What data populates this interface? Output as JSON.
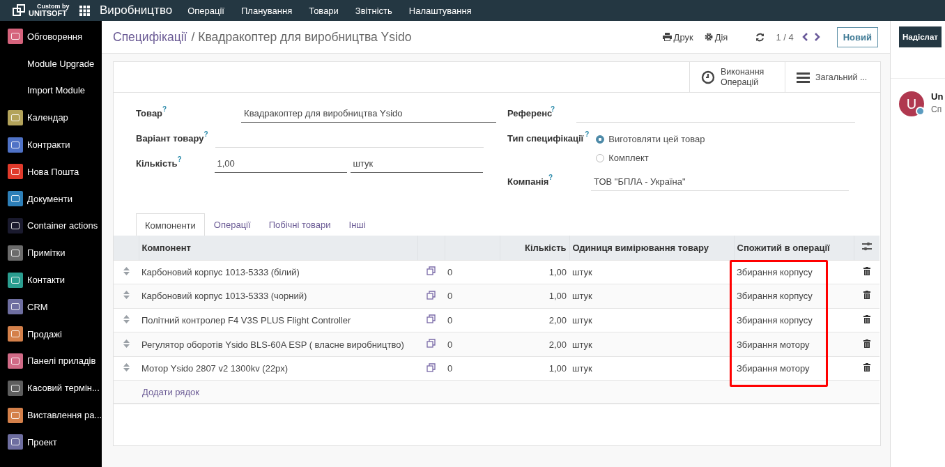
{
  "topbar": {
    "logo_top": "Custom by",
    "logo_bottom": "UNITSOFT",
    "app_name": "Виробництво",
    "menu": [
      "Операції",
      "Планування",
      "Товари",
      "Звітність",
      "Налаштування"
    ]
  },
  "sidebar": {
    "items": [
      {
        "label": "Обговорення"
      },
      {
        "label": "Module Upgrade"
      },
      {
        "label": "Import Module"
      },
      {
        "label": "Календар"
      },
      {
        "label": "Контракти"
      },
      {
        "label": "Нова Пошта"
      },
      {
        "label": "Документи"
      },
      {
        "label": "Container actions"
      },
      {
        "label": "Примітки"
      },
      {
        "label": "Контакти"
      },
      {
        "label": "CRM"
      },
      {
        "label": "Продажі"
      },
      {
        "label": "Панелі приладів"
      },
      {
        "label": "Касовий термін..."
      },
      {
        "label": "Виставлення ра..."
      },
      {
        "label": "Проект"
      }
    ]
  },
  "breadcrumb": {
    "parent": "Специфікації",
    "separator": "/",
    "current": "Квадракоптер для виробництва Ysido"
  },
  "actions": {
    "print": "Друк",
    "action": "Дія",
    "pager": "1 / 4",
    "new_button": "Новий"
  },
  "stat_buttons": [
    {
      "kind": "clock",
      "label": "Виконання Операцій"
    },
    {
      "kind": "menu",
      "label": "Загальний ..."
    }
  ],
  "form": {
    "product_label": "Товар",
    "product_value": "Квадракоптер для виробництва Ysido",
    "variant_label": "Варіант товару",
    "quantity_label": "Кількість",
    "quantity_value": "1,00",
    "uom_value": "штук",
    "help_mark": "?",
    "reference_label": "Референс",
    "type_label": "Тип специфікації",
    "type_options": [
      {
        "label": "Виготовляти цей товар",
        "selected": true
      },
      {
        "label": "Комплект",
        "selected": false
      }
    ],
    "company_label": "Компанія",
    "company_value": "ТОВ \"БПЛА - Україна\""
  },
  "tabs": [
    {
      "label": "Компоненти",
      "selected": true
    },
    {
      "label": "Операції",
      "selected": false
    },
    {
      "label": "Побічні товари",
      "selected": false
    },
    {
      "label": "Інші",
      "selected": false
    }
  ],
  "table": {
    "columns": [
      {
        "label": "Компонент"
      },
      {
        "label": "Кількість"
      },
      {
        "label": "Одиниця вимірювання товару"
      },
      {
        "label": "Спожитий в операції",
        "highlighted": true
      }
    ],
    "rows": [
      {
        "component": "Карбоновий корпус 1013-5333 (білий)",
        "column_3": "0",
        "quantity": "1,00",
        "uom": "штук",
        "operation": "Збирання корпусу"
      },
      {
        "component": "Карбоновий корпус 1013-5333 (чорний)",
        "column_3": "0",
        "quantity": "1,00",
        "uom": "штук",
        "operation": "Збирання корпусу"
      },
      {
        "component": "Політний контролер F4 V3S PLUS Flight Controller",
        "column_3": "0",
        "quantity": "2,00",
        "uom": "штук",
        "operation": "Збирання корпусу"
      },
      {
        "component": "Регулятор оборотів Ysido BLS-60A ESP ( власне виробництво)",
        "column_3": "0",
        "quantity": "2,00",
        "uom": "штук",
        "operation": "Збирання мотору"
      },
      {
        "component": "Мотор Ysido 2807 v2 1300kv (22px)",
        "column_3": "0",
        "quantity": "1,00",
        "uom": "штук",
        "operation": "Збирання мотору"
      }
    ],
    "add_line": "Додати рядок"
  },
  "chatter": {
    "send_button": "Надіслат",
    "author": "Un",
    "preview": "Сп",
    "avatar_letter": "U"
  }
}
